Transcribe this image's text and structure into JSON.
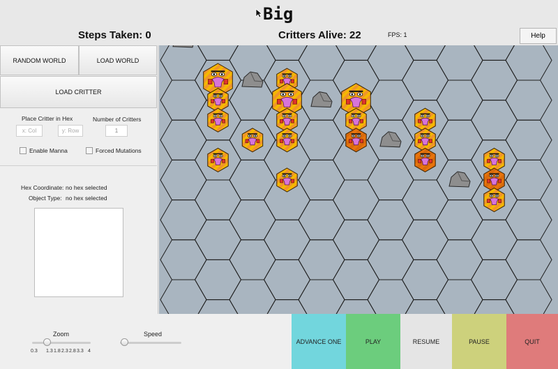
{
  "window": {
    "title": "Big"
  },
  "status": {
    "steps_label": "Steps Taken: 0",
    "critters_label": "Critters Alive: 22",
    "fps_label": "FPS: 1"
  },
  "header": {
    "help_label": "Help"
  },
  "left_panel": {
    "random_world": "RANDOM WORLD",
    "load_world": "LOAD WORLD",
    "load_critter": "LOAD CRITTER",
    "place_label": "Place Critter in Hex",
    "number_label": "Number of Critters",
    "col_placeholder": "x: Col",
    "row_placeholder": "y: Row",
    "count_value": "1",
    "enable_manna": "Enable Manna",
    "forced_mutations": "Forced Mutations",
    "hex_coord_label": "Hex Coordinate:",
    "hex_coord_value": "no hex selected",
    "object_type_label": "Object Type:",
    "object_type_value": "no hex selected"
  },
  "bottom": {
    "zoom_label": "Zoom",
    "zoom_ticks": [
      "0.3",
      "1.3",
      "1.8",
      "2.3",
      "2.8",
      "3.3",
      "4"
    ],
    "zoom_value": 1.3,
    "speed_label": "Speed",
    "speed_value": 0,
    "advance_label": "ADVANCE ONE",
    "play_label": "PLAY",
    "resume_label": "RESUME",
    "pause_label": "PAUSE",
    "quit_label": "QUIT"
  },
  "colors": {
    "map_bg": "#a9b5c0",
    "advance": "#72d6dd",
    "play": "#6ccd7d",
    "resume": "#e5e5e5",
    "pause": "#cdd17c",
    "quit": "#df7b7b",
    "hex_yellow": "#f5b800",
    "hex_orange": "#e8740c"
  },
  "world": {
    "critters_alive": 22,
    "critters": [
      {
        "col": 1,
        "row": 3,
        "color": "yellow",
        "big": true
      },
      {
        "col": 1,
        "row": 4,
        "color": "yellow"
      },
      {
        "col": 1,
        "row": 5,
        "color": "yellow"
      },
      {
        "col": 1,
        "row": 7,
        "color": "yellow"
      },
      {
        "col": 2,
        "row": 6,
        "color": "yellow"
      },
      {
        "col": 3,
        "row": 3,
        "color": "yellow"
      },
      {
        "col": 3,
        "row": 4,
        "color": "yellow",
        "big": true
      },
      {
        "col": 3,
        "row": 5,
        "color": "yellow"
      },
      {
        "col": 3,
        "row": 6,
        "color": "yellow"
      },
      {
        "col": 3,
        "row": 8,
        "color": "yellow"
      },
      {
        "col": 5,
        "row": 4,
        "color": "yellow",
        "big": true
      },
      {
        "col": 5,
        "row": 5,
        "color": "yellow"
      },
      {
        "col": 5,
        "row": 6,
        "color": "orange"
      },
      {
        "col": 7,
        "row": 5,
        "color": "yellow"
      },
      {
        "col": 7,
        "row": 6,
        "color": "yellow"
      },
      {
        "col": 7,
        "row": 7,
        "color": "orange"
      },
      {
        "col": 9,
        "row": 7,
        "color": "yellow"
      },
      {
        "col": 9,
        "row": 8,
        "color": "orange"
      },
      {
        "col": 9,
        "row": 9,
        "color": "yellow"
      }
    ],
    "rocks": [
      {
        "col": 0,
        "row": 1
      },
      {
        "col": 2,
        "row": 3
      },
      {
        "col": 4,
        "row": 4
      },
      {
        "col": 6,
        "row": 6
      },
      {
        "col": 8,
        "row": 8
      }
    ]
  }
}
